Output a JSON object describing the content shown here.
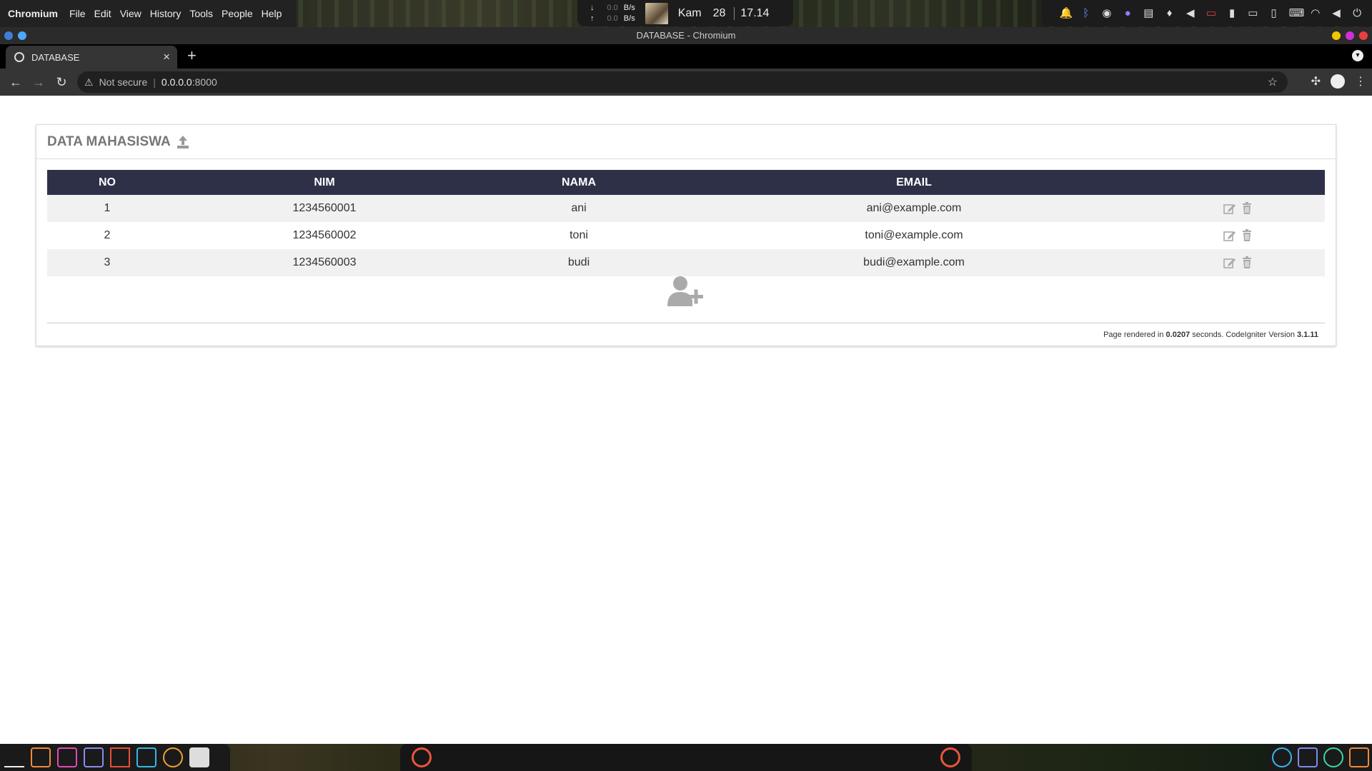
{
  "system_bar": {
    "app_name": "Chromium",
    "menu": [
      "File",
      "Edit",
      "View",
      "History",
      "Tools",
      "People",
      "Help"
    ],
    "net_down_label": "↓",
    "net_up_label": "↑",
    "net_down_value": "0.0",
    "net_up_value": "0.0",
    "net_unit": "B/s",
    "day": "Kam",
    "date": "28",
    "time": "17.14"
  },
  "window": {
    "title": "DATABASE - Chromium"
  },
  "tab": {
    "title": "DATABASE",
    "close_label": "×",
    "new_tab_label": "+"
  },
  "address_bar": {
    "security_label": "Not secure",
    "url_host": "0.0.0.0",
    "url_port": ":8000"
  },
  "page": {
    "title": "DATA MAHASISWA",
    "table": {
      "columns": [
        "NO",
        "NIM",
        "NAMA",
        "EMAIL"
      ],
      "rows": [
        {
          "no": "1",
          "nim": "1234560001",
          "nama": "ani",
          "email": "ani@example.com"
        },
        {
          "no": "2",
          "nim": "1234560002",
          "nama": "toni",
          "email": "toni@example.com"
        },
        {
          "no": "3",
          "nim": "1234560003",
          "nama": "budi",
          "email": "budi@example.com"
        }
      ]
    },
    "footer": {
      "prefix": "Page rendered in ",
      "seconds": "0.0207",
      "middle": " seconds. CodeIgniter Version ",
      "version": "3.1.11"
    }
  },
  "icons": {
    "upload": "upload-icon",
    "edit": "edit-icon",
    "delete": "trash-icon",
    "add_user": "user-plus-icon"
  },
  "colors": {
    "table_header": "#2d3047",
    "row_stripe": "#f1f1f1",
    "title_text": "#777777"
  }
}
